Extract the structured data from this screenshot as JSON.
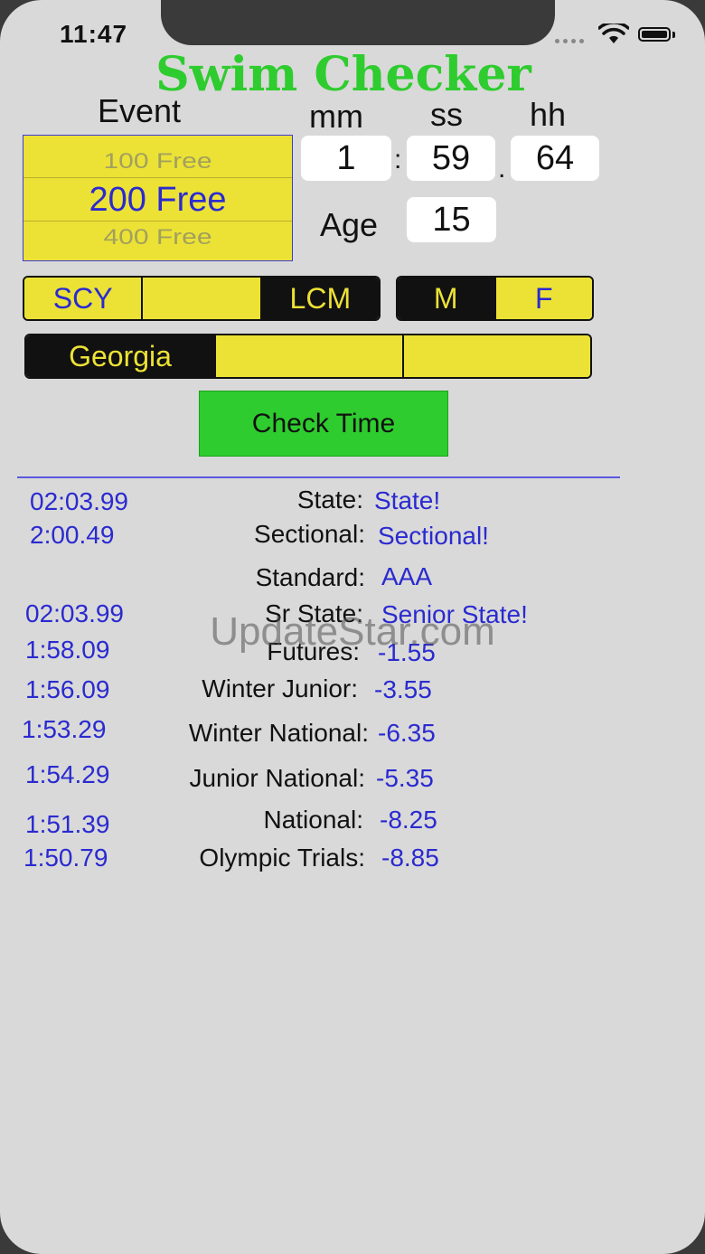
{
  "status_bar": {
    "time": "11:47"
  },
  "app_title": "Swim Checker",
  "labels": {
    "event": "Event",
    "mm": "mm",
    "ss": "ss",
    "hh": "hh",
    "age": "Age"
  },
  "event_picker": {
    "above": "100 Free",
    "selected": "200 Free",
    "below": "400 Free"
  },
  "time_entry": {
    "mm": "1",
    "ss": "59",
    "hh": "64",
    "sep1": ":",
    "sep2": "."
  },
  "age": "15",
  "course_options": [
    "SCY",
    "",
    "LCM"
  ],
  "course_selected_index": 2,
  "gender_options": [
    "M",
    "F"
  ],
  "gender_selected_index": 0,
  "region_options": [
    "Georgia",
    "",
    ""
  ],
  "region_selected_index": 0,
  "check_button": "Check Time",
  "results": [
    {
      "time": "02:03.99",
      "label": "State:",
      "value": "State!"
    },
    {
      "time": "2:00.49",
      "label": "Sectional:",
      "value": "Sectional!"
    },
    {
      "time": "",
      "label": "Standard:",
      "value": "AAA"
    },
    {
      "time": "02:03.99",
      "label": "Sr State:",
      "value": "Senior State!"
    },
    {
      "time": "1:58.09",
      "label": "Futures:",
      "value": "-1.55"
    },
    {
      "time": "1:56.09",
      "label": "Winter Junior:",
      "value": "-3.55"
    },
    {
      "time": "1:53.29",
      "label": "Winter National:",
      "value": "-6.35"
    },
    {
      "time": "1:54.29",
      "label": "Junior National:",
      "value": "-5.35"
    },
    {
      "time": "1:51.39",
      "label": "National:",
      "value": "-8.25"
    },
    {
      "time": "1:50.79",
      "label": "Olympic Trials:",
      "value": "-8.85"
    }
  ],
  "watermark": "UpdateStar.com",
  "colors": {
    "accent_green": "#2ecc2e",
    "segment_yellow": "#ece236",
    "text_blue": "#2a2ad0",
    "background": "#d9d9d9"
  }
}
